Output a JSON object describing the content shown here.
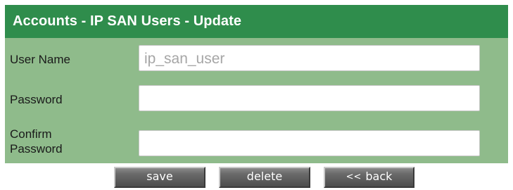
{
  "panel": {
    "title": "Accounts - IP SAN Users - Update"
  },
  "form": {
    "user_name": {
      "label": "User Name",
      "value": "ip_san_user"
    },
    "password": {
      "label": "Password",
      "value": ""
    },
    "confirm_password": {
      "label_line1": "Confirm",
      "label_line2": "Password",
      "value": ""
    }
  },
  "buttons": {
    "save_label": "save",
    "delete_label": "delete",
    "back_icon": "<<",
    "back_label": "back"
  },
  "colors": {
    "header_bg": "#2f8d4c",
    "panel_bg": "#8fbb8b",
    "button_bg": "#606060"
  }
}
